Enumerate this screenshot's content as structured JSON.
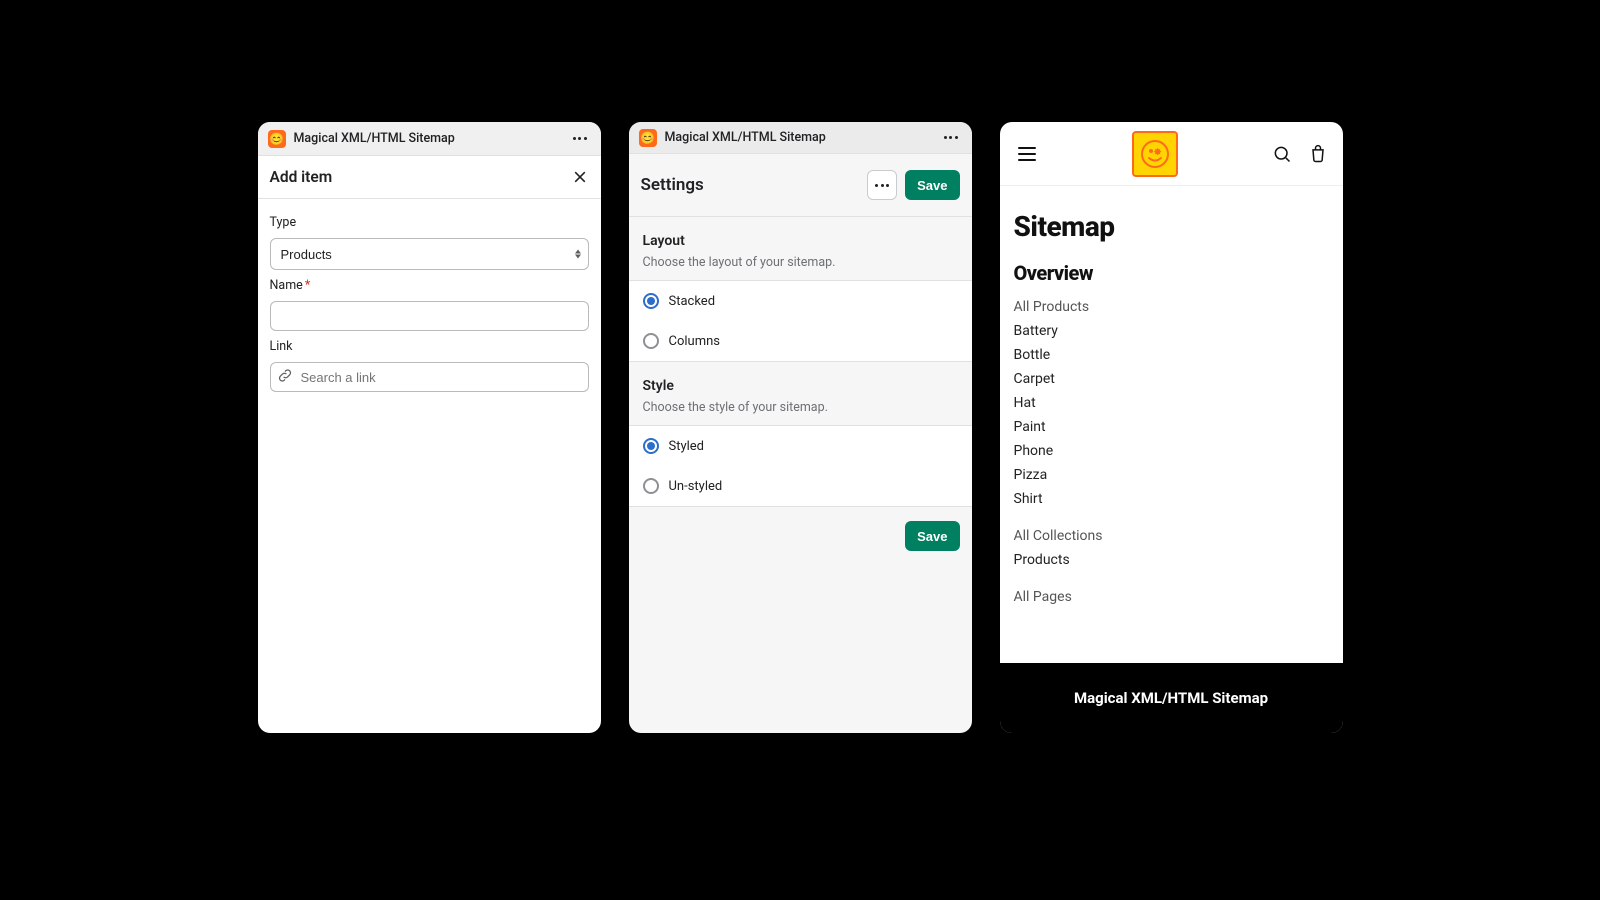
{
  "colors": {
    "primary": "#008060",
    "accent": "#2c6ecb"
  },
  "panel1": {
    "app_title": "Magical XML/HTML Sitemap",
    "heading": "Add item",
    "type_label": "Type",
    "type_value": "Products",
    "name_label": "Name",
    "name_value": "",
    "link_label": "Link",
    "link_placeholder": "Search a link"
  },
  "panel2": {
    "app_title": "Magical XML/HTML Sitemap",
    "heading": "Settings",
    "save_label": "Save",
    "layout": {
      "title": "Layout",
      "subtitle": "Choose the layout of your sitemap.",
      "options": [
        "Stacked",
        "Columns"
      ],
      "selected": "Stacked"
    },
    "style": {
      "title": "Style",
      "subtitle": "Choose the style of your sitemap.",
      "options": [
        "Styled",
        "Un-styled"
      ],
      "selected": "Styled"
    },
    "footer_save": "Save"
  },
  "panel3": {
    "title": "Sitemap",
    "overview_heading": "Overview",
    "groups": [
      {
        "heading": "All Products",
        "items": [
          "Battery",
          "Bottle",
          "Carpet",
          "Hat",
          "Paint",
          "Phone",
          "Pizza",
          "Shirt"
        ]
      },
      {
        "heading": "All Collections",
        "items": [
          "Products"
        ]
      },
      {
        "heading": "All Pages",
        "items": []
      }
    ],
    "footer": "Magical XML/HTML Sitemap"
  }
}
